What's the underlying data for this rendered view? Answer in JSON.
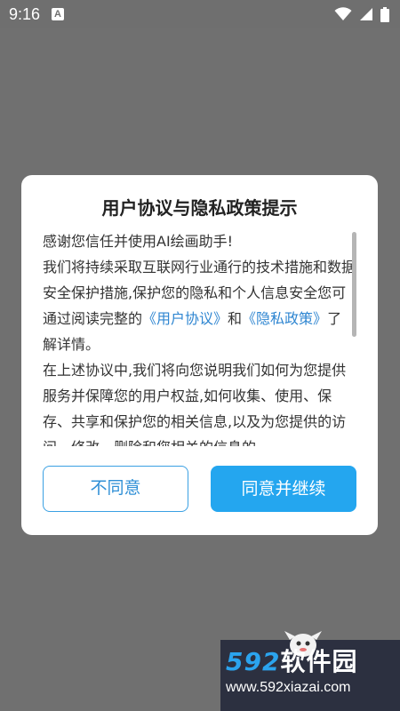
{
  "status_bar": {
    "time": "9:16",
    "notification_letter": "A"
  },
  "dialog": {
    "title": "用户协议与隐私政策提示",
    "intro": "感谢您信任并使用AI绘画助手!",
    "paragraph1_before": "我们将持续采取互联网行业通行的技术措施和数据安全保护措施,保护您的隐私和个人信息安全您可通过阅读完整的",
    "user_agreement_link": "《用户协议》",
    "and": "和",
    "privacy_policy_link": "《隐私政策》",
    "paragraph1_after": "了解详情。",
    "paragraph2": "在上述协议中,我们将向您说明我们如何为您提供服务并保障您的用户权益,如何收集、使用、保存、共享和保护您的相关信息,以及为您提供的访问、修改、删除和您相关的信息的",
    "disagree_label": "不同意",
    "agree_label": "同意并继续"
  },
  "watermark": {
    "logo_number": "592",
    "logo_text": "软件园",
    "url": "www.592xiazai.com"
  },
  "colors": {
    "overlay": "#707070",
    "primary": "#24a6ef",
    "link": "#2f86d1"
  }
}
